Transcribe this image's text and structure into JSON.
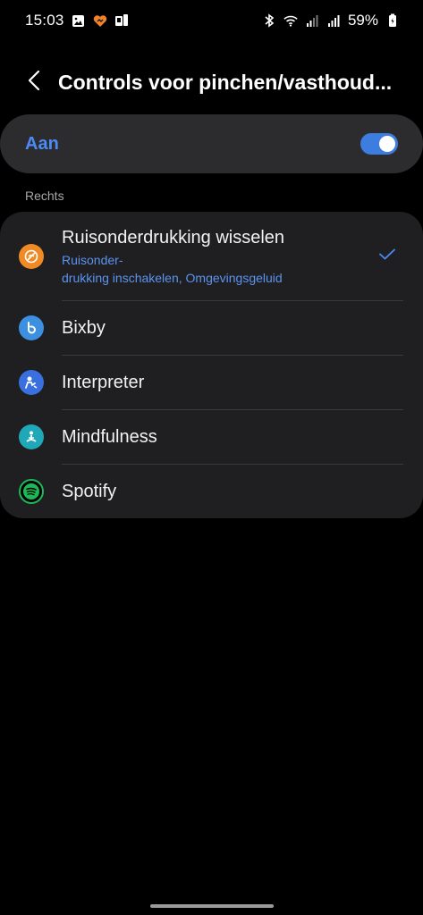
{
  "status_bar": {
    "time": "15:03",
    "battery": "59%",
    "icons_left": [
      "image-icon",
      "heart-icon",
      "device-icon"
    ],
    "icons_right": [
      "bluetooth-icon",
      "wifi-icon",
      "signal-icon",
      "signal-icon",
      "battery-icon"
    ]
  },
  "header": {
    "title": "Controls voor pinchen/vasthoud..."
  },
  "master_toggle": {
    "label": "Aan",
    "on": true
  },
  "section": {
    "label": "Rechts"
  },
  "items": [
    {
      "title": "Ruisonderdrukking wisselen",
      "subtitle_line1": "Ruisonder-",
      "subtitle_line2": "drukking inschakelen, Omgevingsgeluid",
      "icon": "noise-control-icon",
      "icon_color": "#f08a24",
      "selected": true
    },
    {
      "title": "Bixby",
      "icon": "bixby-icon",
      "icon_color": "#3d8fe0",
      "selected": false
    },
    {
      "title": "Interpreter",
      "icon": "interpreter-icon",
      "icon_color": "#3a6fe0",
      "selected": false
    },
    {
      "title": "Mindfulness",
      "icon": "mindfulness-icon",
      "icon_color": "#1fa8b8",
      "selected": false
    },
    {
      "title": "Spotify",
      "icon": "spotify-icon",
      "icon_color": "#1db954",
      "selected": false
    }
  ],
  "colors": {
    "accent": "#4c8bf5",
    "card": "#2c2c2e",
    "list_card": "#1f1f21",
    "background": "#000000"
  }
}
